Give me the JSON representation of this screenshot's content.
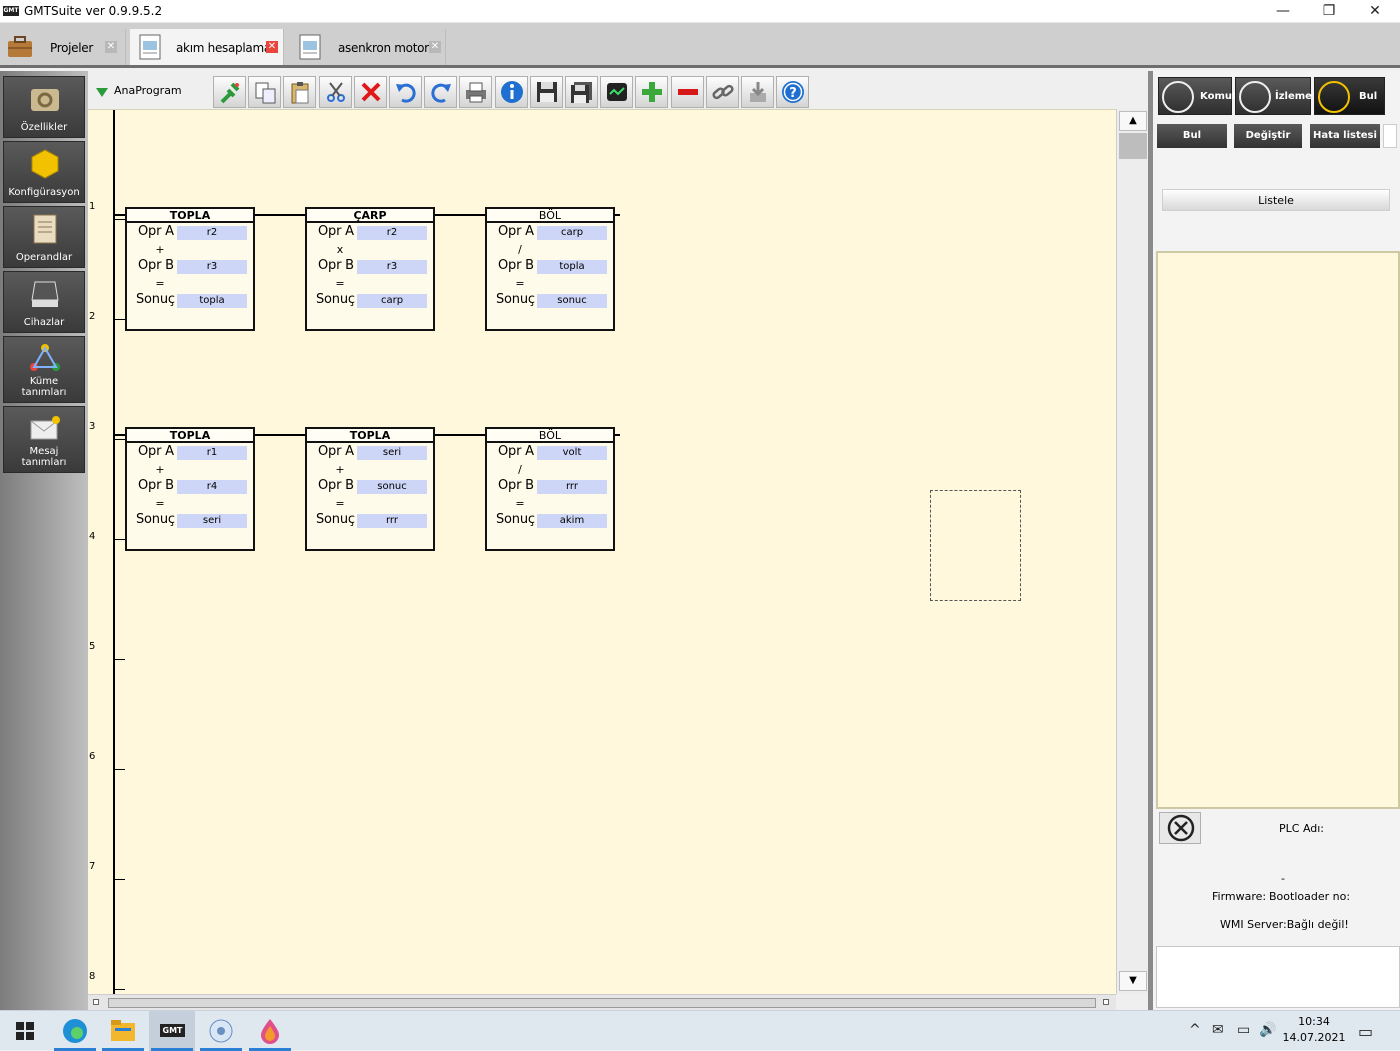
{
  "window": {
    "title": "GMTSuite ver 0.9.9.5.2",
    "logo_text": "GMT",
    "minimize": "—",
    "maximize": "❐",
    "close": "✕"
  },
  "tabs": [
    {
      "label": "Projeler",
      "close": "✕"
    },
    {
      "label": "akım hesaplama",
      "close": "✕"
    },
    {
      "label": "asenkron motor",
      "close": "✕"
    }
  ],
  "sidebar": [
    {
      "label": "Özellikler",
      "icon": "gear-icon"
    },
    {
      "label": "Konfigürasyon",
      "icon": "hexagon-icon"
    },
    {
      "label": "Operandlar",
      "icon": "notebook-icon"
    },
    {
      "label": "Cihazlar",
      "icon": "hard-drive-icon"
    },
    {
      "label": "Küme tanımları",
      "icon": "network-icon"
    },
    {
      "label": "Mesaj tanımları",
      "icon": "envelope-icon"
    }
  ],
  "toolbar": {
    "program_select": "AnaProgram",
    "buttons": [
      "connect-icon",
      "copy-icon",
      "paste-icon",
      "cut-icon",
      "delete-icon",
      "undo-icon",
      "redo-icon",
      "print-icon",
      "info-icon",
      "save-icon",
      "save-all-icon",
      "monitor-icon",
      "add-icon",
      "remove-icon",
      "link-icon",
      "download-icon",
      "help-icon"
    ]
  },
  "ladder": {
    "rows": [
      "1",
      "2",
      "3",
      "4",
      "5",
      "6",
      "7",
      "8"
    ],
    "blocks": [
      {
        "title": "TOPLA",
        "op": "+",
        "a_label": "Opr A",
        "b_label": "Opr B",
        "eq": "=",
        "result_label": "Sonuç",
        "a": "r2",
        "b": "r3",
        "result": "topla"
      },
      {
        "title": "ÇARP",
        "op": "x",
        "a_label": "Opr A",
        "b_label": "Opr B",
        "eq": "=",
        "result_label": "Sonuç",
        "a": "r2",
        "b": "r3",
        "result": "carp"
      },
      {
        "title": "BÖL",
        "op": "/",
        "a_label": "Opr A",
        "b_label": "Opr B",
        "eq": "=",
        "result_label": "Sonuç",
        "a": "carp",
        "b": "topla",
        "result": "sonuc"
      },
      {
        "title": "TOPLA",
        "op": "+",
        "a_label": "Opr A",
        "b_label": "Opr B",
        "eq": "=",
        "result_label": "Sonuç",
        "a": "r1",
        "b": "r4",
        "result": "seri"
      },
      {
        "title": "TOPLA",
        "op": "+",
        "a_label": "Opr A",
        "b_label": "Opr B",
        "eq": "=",
        "result_label": "Sonuç",
        "a": "seri",
        "b": "sonuc",
        "result": "rrr"
      },
      {
        "title": "BÖL",
        "op": "/",
        "a_label": "Opr A",
        "b_label": "Opr B",
        "eq": "=",
        "result_label": "Sonuç",
        "a": "volt",
        "b": "rrr",
        "result": "akim"
      }
    ]
  },
  "scroll": {
    "up": "▲",
    "down": "▼"
  },
  "right_panel": {
    "tabs": [
      {
        "label": "Komut"
      },
      {
        "label": "İzleme"
      },
      {
        "label": "Bul"
      }
    ],
    "search_buttons": [
      "Bul",
      "Değiştir",
      "Hata listesi"
    ],
    "list_button": "Listele",
    "plc_name_label": "PLC Adı:",
    "dash": "-",
    "firmware_label": "Firmware:",
    "bootloader_label": "Bootloader no:",
    "wmi_status": "WMI Server:Bağlı değil!"
  },
  "taskbar": {
    "apps": [
      "windows-start-icon",
      "edge-icon",
      "file-explorer-icon",
      "gmt-icon",
      "app-icon",
      "drop-icon"
    ],
    "gmt_text": "GMT",
    "time": "10:34",
    "date": "14.07.2021",
    "tray": [
      "^",
      "✉",
      "▭",
      "🔊"
    ],
    "notification": "▭"
  },
  "colors": {
    "canvas_bg": "#fff8dc",
    "operand_bg": "#cdd6f6",
    "accent_red": "#e8453c",
    "accent_green": "#2b9a3a"
  }
}
